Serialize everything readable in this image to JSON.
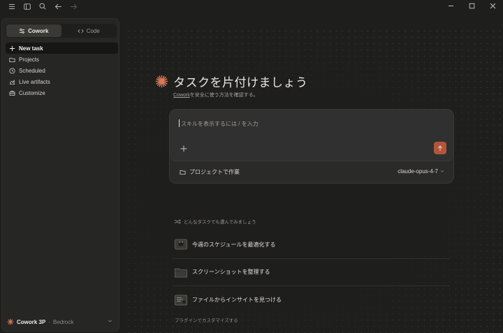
{
  "sidebar": {
    "modes": [
      {
        "label": "Cowork",
        "icon": "sliders-icon",
        "active": true
      },
      {
        "label": "Code",
        "icon": "code-icon",
        "active": false
      }
    ],
    "items": [
      {
        "label": "New task",
        "icon": "plus-icon"
      },
      {
        "label": "Projects",
        "icon": "folder-icon"
      },
      {
        "label": "Scheduled",
        "icon": "clock-icon"
      },
      {
        "label": "Live artifacts",
        "icon": "artifacts-icon"
      },
      {
        "label": "Customize",
        "icon": "briefcase-icon"
      }
    ],
    "account": {
      "name": "Cowork 3P",
      "separator": "·",
      "provider": "Bedrock"
    }
  },
  "main": {
    "title": "タスクを片付けましょう",
    "subtitle_link": "Cowork",
    "subtitle_rest": "を安全に使う方法を確認する。",
    "composer": {
      "placeholder": "スキルを表示するには / を入力",
      "project_label": "プロジェクトで作業",
      "model": "claude-opus-4-7"
    },
    "suggestions_header": "どんなタスクでも選んでみましょう",
    "suggestions": [
      {
        "label": "今週のスケジュールを最適化する",
        "icon": "calendar-icon"
      },
      {
        "label": "スクリーンショットを整理する",
        "icon": "folder-icon"
      },
      {
        "label": "ファイルからインサイトを見つける",
        "icon": "document-icon"
      }
    ],
    "plugin_link": "プラグインでカスタマイズする"
  },
  "colors": {
    "accent": "#d97757",
    "send": "#b0563b",
    "background": "#1e1e1d",
    "sidebar": "#262624"
  }
}
